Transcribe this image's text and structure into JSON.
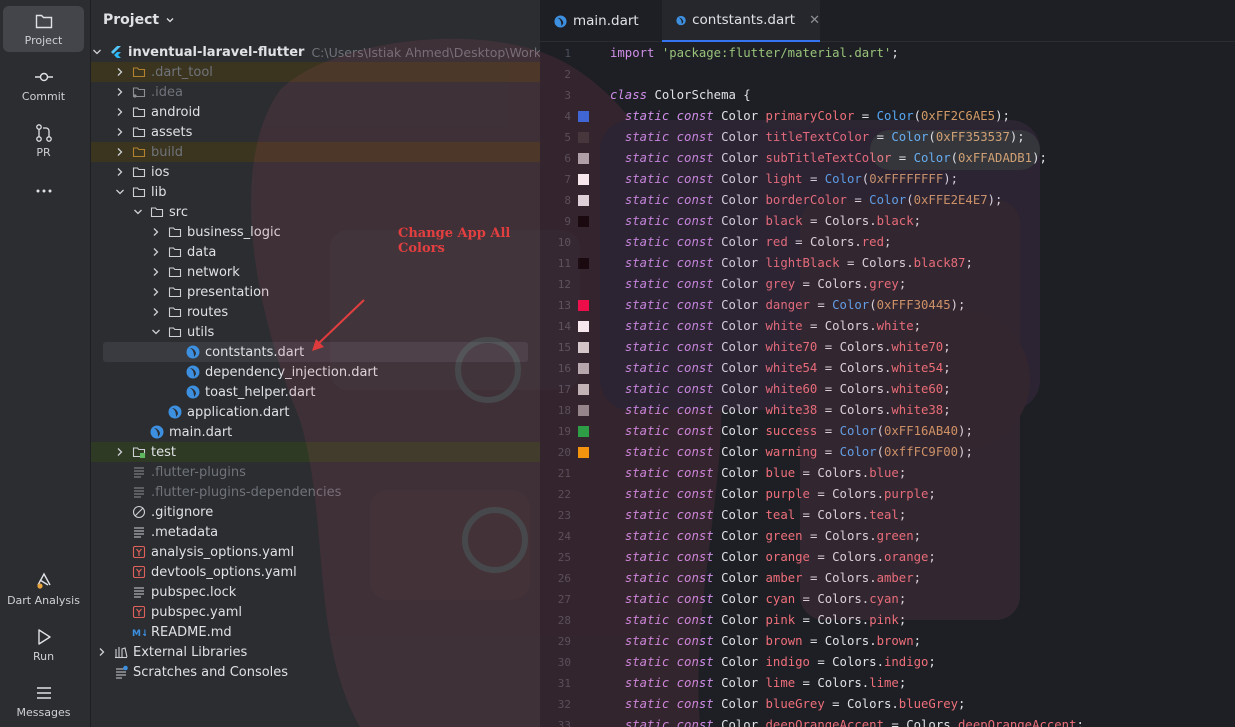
{
  "activity": [
    {
      "label": "Project",
      "icon": "folder-icon"
    },
    {
      "label": "Commit",
      "icon": "commit-icon"
    },
    {
      "label": "PR",
      "icon": "pull-request-icon"
    },
    {
      "label": "",
      "icon": "more-icon"
    },
    {
      "label": "Dart Analysis",
      "icon": "dart-analysis-icon"
    },
    {
      "label": "Run",
      "icon": "run-icon"
    },
    {
      "label": "Messages",
      "icon": "messages-icon"
    }
  ],
  "project": {
    "title": "Project",
    "root_name": "inventual-laravel-flutter",
    "root_path": "C:\\Users\\Istiak Ahmed\\Desktop\\Work Pla",
    "items": [
      {
        "name": ".dart_tool",
        "kind": "folder-ignored",
        "depth": 1,
        "chev": "right"
      },
      {
        "name": ".idea",
        "kind": "folder-dim",
        "depth": 1,
        "chev": "right"
      },
      {
        "name": "android",
        "kind": "folder",
        "depth": 1,
        "chev": "right"
      },
      {
        "name": "assets",
        "kind": "folder",
        "depth": 1,
        "chev": "right"
      },
      {
        "name": "build",
        "kind": "folder-ignored",
        "depth": 1,
        "chev": "right"
      },
      {
        "name": "ios",
        "kind": "folder",
        "depth": 1,
        "chev": "right"
      },
      {
        "name": "lib",
        "kind": "folder",
        "depth": 1,
        "chev": "down"
      },
      {
        "name": "src",
        "kind": "folder",
        "depth": 2,
        "chev": "down"
      },
      {
        "name": "business_logic",
        "kind": "folder",
        "depth": 3,
        "chev": "right"
      },
      {
        "name": "data",
        "kind": "folder",
        "depth": 3,
        "chev": "right"
      },
      {
        "name": "network",
        "kind": "folder",
        "depth": 3,
        "chev": "right"
      },
      {
        "name": "presentation",
        "kind": "folder",
        "depth": 3,
        "chev": "right"
      },
      {
        "name": "routes",
        "kind": "folder",
        "depth": 3,
        "chev": "right"
      },
      {
        "name": "utils",
        "kind": "folder",
        "depth": 3,
        "chev": "down"
      },
      {
        "name": "contstants.dart",
        "kind": "dart",
        "depth": 4,
        "chev": "none",
        "selected": true
      },
      {
        "name": "dependency_injection.dart",
        "kind": "dart",
        "depth": 4,
        "chev": "none"
      },
      {
        "name": "toast_helper.dart",
        "kind": "dart",
        "depth": 4,
        "chev": "none"
      },
      {
        "name": "application.dart",
        "kind": "dart",
        "depth": 3,
        "chev": "none"
      },
      {
        "name": "main.dart",
        "kind": "dart",
        "depth": 2,
        "chev": "none"
      },
      {
        "name": "test",
        "kind": "folder-test",
        "depth": 1,
        "chev": "right"
      },
      {
        "name": ".flutter-plugins",
        "kind": "file-dim",
        "depth": 1,
        "chev": "none"
      },
      {
        "name": ".flutter-plugins-dependencies",
        "kind": "file-dim",
        "depth": 1,
        "chev": "none"
      },
      {
        "name": ".gitignore",
        "kind": "gitignore",
        "depth": 1,
        "chev": "none"
      },
      {
        "name": ".metadata",
        "kind": "file",
        "depth": 1,
        "chev": "none"
      },
      {
        "name": "analysis_options.yaml",
        "kind": "yaml",
        "depth": 1,
        "chev": "none"
      },
      {
        "name": "devtools_options.yaml",
        "kind": "yaml",
        "depth": 1,
        "chev": "none"
      },
      {
        "name": "pubspec.lock",
        "kind": "file",
        "depth": 1,
        "chev": "none"
      },
      {
        "name": "pubspec.yaml",
        "kind": "yaml",
        "depth": 1,
        "chev": "none"
      },
      {
        "name": "README.md",
        "kind": "md",
        "depth": 1,
        "chev": "none"
      },
      {
        "name": "External Libraries",
        "kind": "library",
        "depth": 0,
        "chev": "right"
      },
      {
        "name": "Scratches and Consoles",
        "kind": "scratch",
        "depth": 0,
        "chev": "none"
      }
    ]
  },
  "annotation": "Change App All Colors",
  "tabs": [
    {
      "label": "main.dart",
      "active": false
    },
    {
      "label": "contstants.dart",
      "active": true
    }
  ],
  "code": {
    "import_kw": "import",
    "import_str": "'package:flutter/material.dart'",
    "class_kw": "class",
    "class_name": "ColorSchema",
    "fields": [
      {
        "name": "primaryColor",
        "ctor": "Color",
        "arg": "0xFF2C6AE5",
        "swatch": "#2C6AE5"
      },
      {
        "name": "titleTextColor",
        "ctor": "Color",
        "arg": "0xFF353537",
        "swatch": "#353537"
      },
      {
        "name": "subTitleTextColor",
        "ctor": "Color",
        "arg": "0xFFADADB1",
        "swatch": "#ADADB1"
      },
      {
        "name": "light",
        "ctor": "Color",
        "arg": "0xFFFFFFFF",
        "swatch": "#FFFFFF"
      },
      {
        "name": "borderColor",
        "ctor": "Color",
        "arg": "0xFFE2E4E7",
        "swatch": "#E2E4E7"
      },
      {
        "name": "black",
        "ref": "black",
        "swatch": "#000000"
      },
      {
        "name": "red",
        "ref": "red",
        "swatch": ""
      },
      {
        "name": "lightBlack",
        "ref": "black87",
        "swatch": "#000000"
      },
      {
        "name": "grey",
        "ref": "grey",
        "swatch": ""
      },
      {
        "name": "danger",
        "ctor": "Color",
        "arg": "0xFFF30445",
        "swatch": "#F30445"
      },
      {
        "name": "white",
        "ref": "white",
        "swatch": "#FFFFFF"
      },
      {
        "name": "white70",
        "ref": "white70",
        "swatch": "#D8D8D8"
      },
      {
        "name": "white54",
        "ref": "white54",
        "swatch": "#B5B5B5"
      },
      {
        "name": "white60",
        "ref": "white60",
        "swatch": "#C2C2C2"
      },
      {
        "name": "white38",
        "ref": "white38",
        "swatch": "#8F8F8F"
      },
      {
        "name": "success",
        "ctor": "Color",
        "arg": "0xFF16AB40",
        "swatch": "#16AB40"
      },
      {
        "name": "warning",
        "ctor": "Color",
        "arg": "0xffFC9F00",
        "swatch": "#FC9F00"
      },
      {
        "name": "blue",
        "ref": "blue",
        "swatch": ""
      },
      {
        "name": "purple",
        "ref": "purple",
        "swatch": ""
      },
      {
        "name": "teal",
        "ref": "teal",
        "swatch": ""
      },
      {
        "name": "green",
        "ref": "green",
        "swatch": ""
      },
      {
        "name": "orange",
        "ref": "orange",
        "swatch": ""
      },
      {
        "name": "amber",
        "ref": "amber",
        "swatch": ""
      },
      {
        "name": "cyan",
        "ref": "cyan",
        "swatch": ""
      },
      {
        "name": "pink",
        "ref": "pink",
        "swatch": ""
      },
      {
        "name": "brown",
        "ref": "brown",
        "swatch": ""
      },
      {
        "name": "indigo",
        "ref": "indigo",
        "swatch": ""
      },
      {
        "name": "lime",
        "ref": "lime",
        "swatch": ""
      },
      {
        "name": "blueGrey",
        "ref": "blueGrey",
        "swatch": ""
      },
      {
        "name": "deepOrangeAccent",
        "ref": "deepOrangeAccent",
        "swatch": ""
      }
    ]
  },
  "colors": {
    "accent": "#3574f0",
    "annotation": "#e53935",
    "keyword": "#cf8ee8",
    "field": "#ef6f7a",
    "ctor": "#56a8f5"
  }
}
